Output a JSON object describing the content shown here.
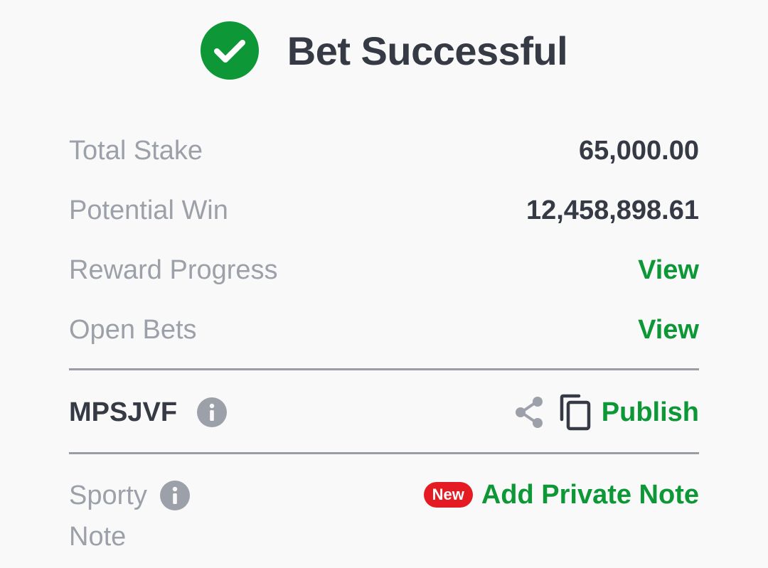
{
  "header": {
    "title": "Bet Successful",
    "icon": "check-circle-icon",
    "icon_color": "#0d9737"
  },
  "summary": {
    "total_stake_label": "Total Stake",
    "total_stake_value": "65,000.00",
    "potential_win_label": "Potential Win",
    "potential_win_value": "12,458,898.61",
    "reward_progress_label": "Reward Progress",
    "reward_progress_link": "View",
    "open_bets_label": "Open Bets",
    "open_bets_link": "View"
  },
  "booking": {
    "code": "MPSJVF",
    "publish_label": "Publish"
  },
  "note": {
    "label_line1": "Sporty",
    "label_line2": "Note",
    "badge": "New",
    "action_label": "Add Private Note"
  },
  "colors": {
    "accent_green": "#0d9737",
    "text_dark": "#353a45",
    "text_muted": "#9ca0a8",
    "badge_red": "#e41b23",
    "background": "#f9f9f9"
  }
}
